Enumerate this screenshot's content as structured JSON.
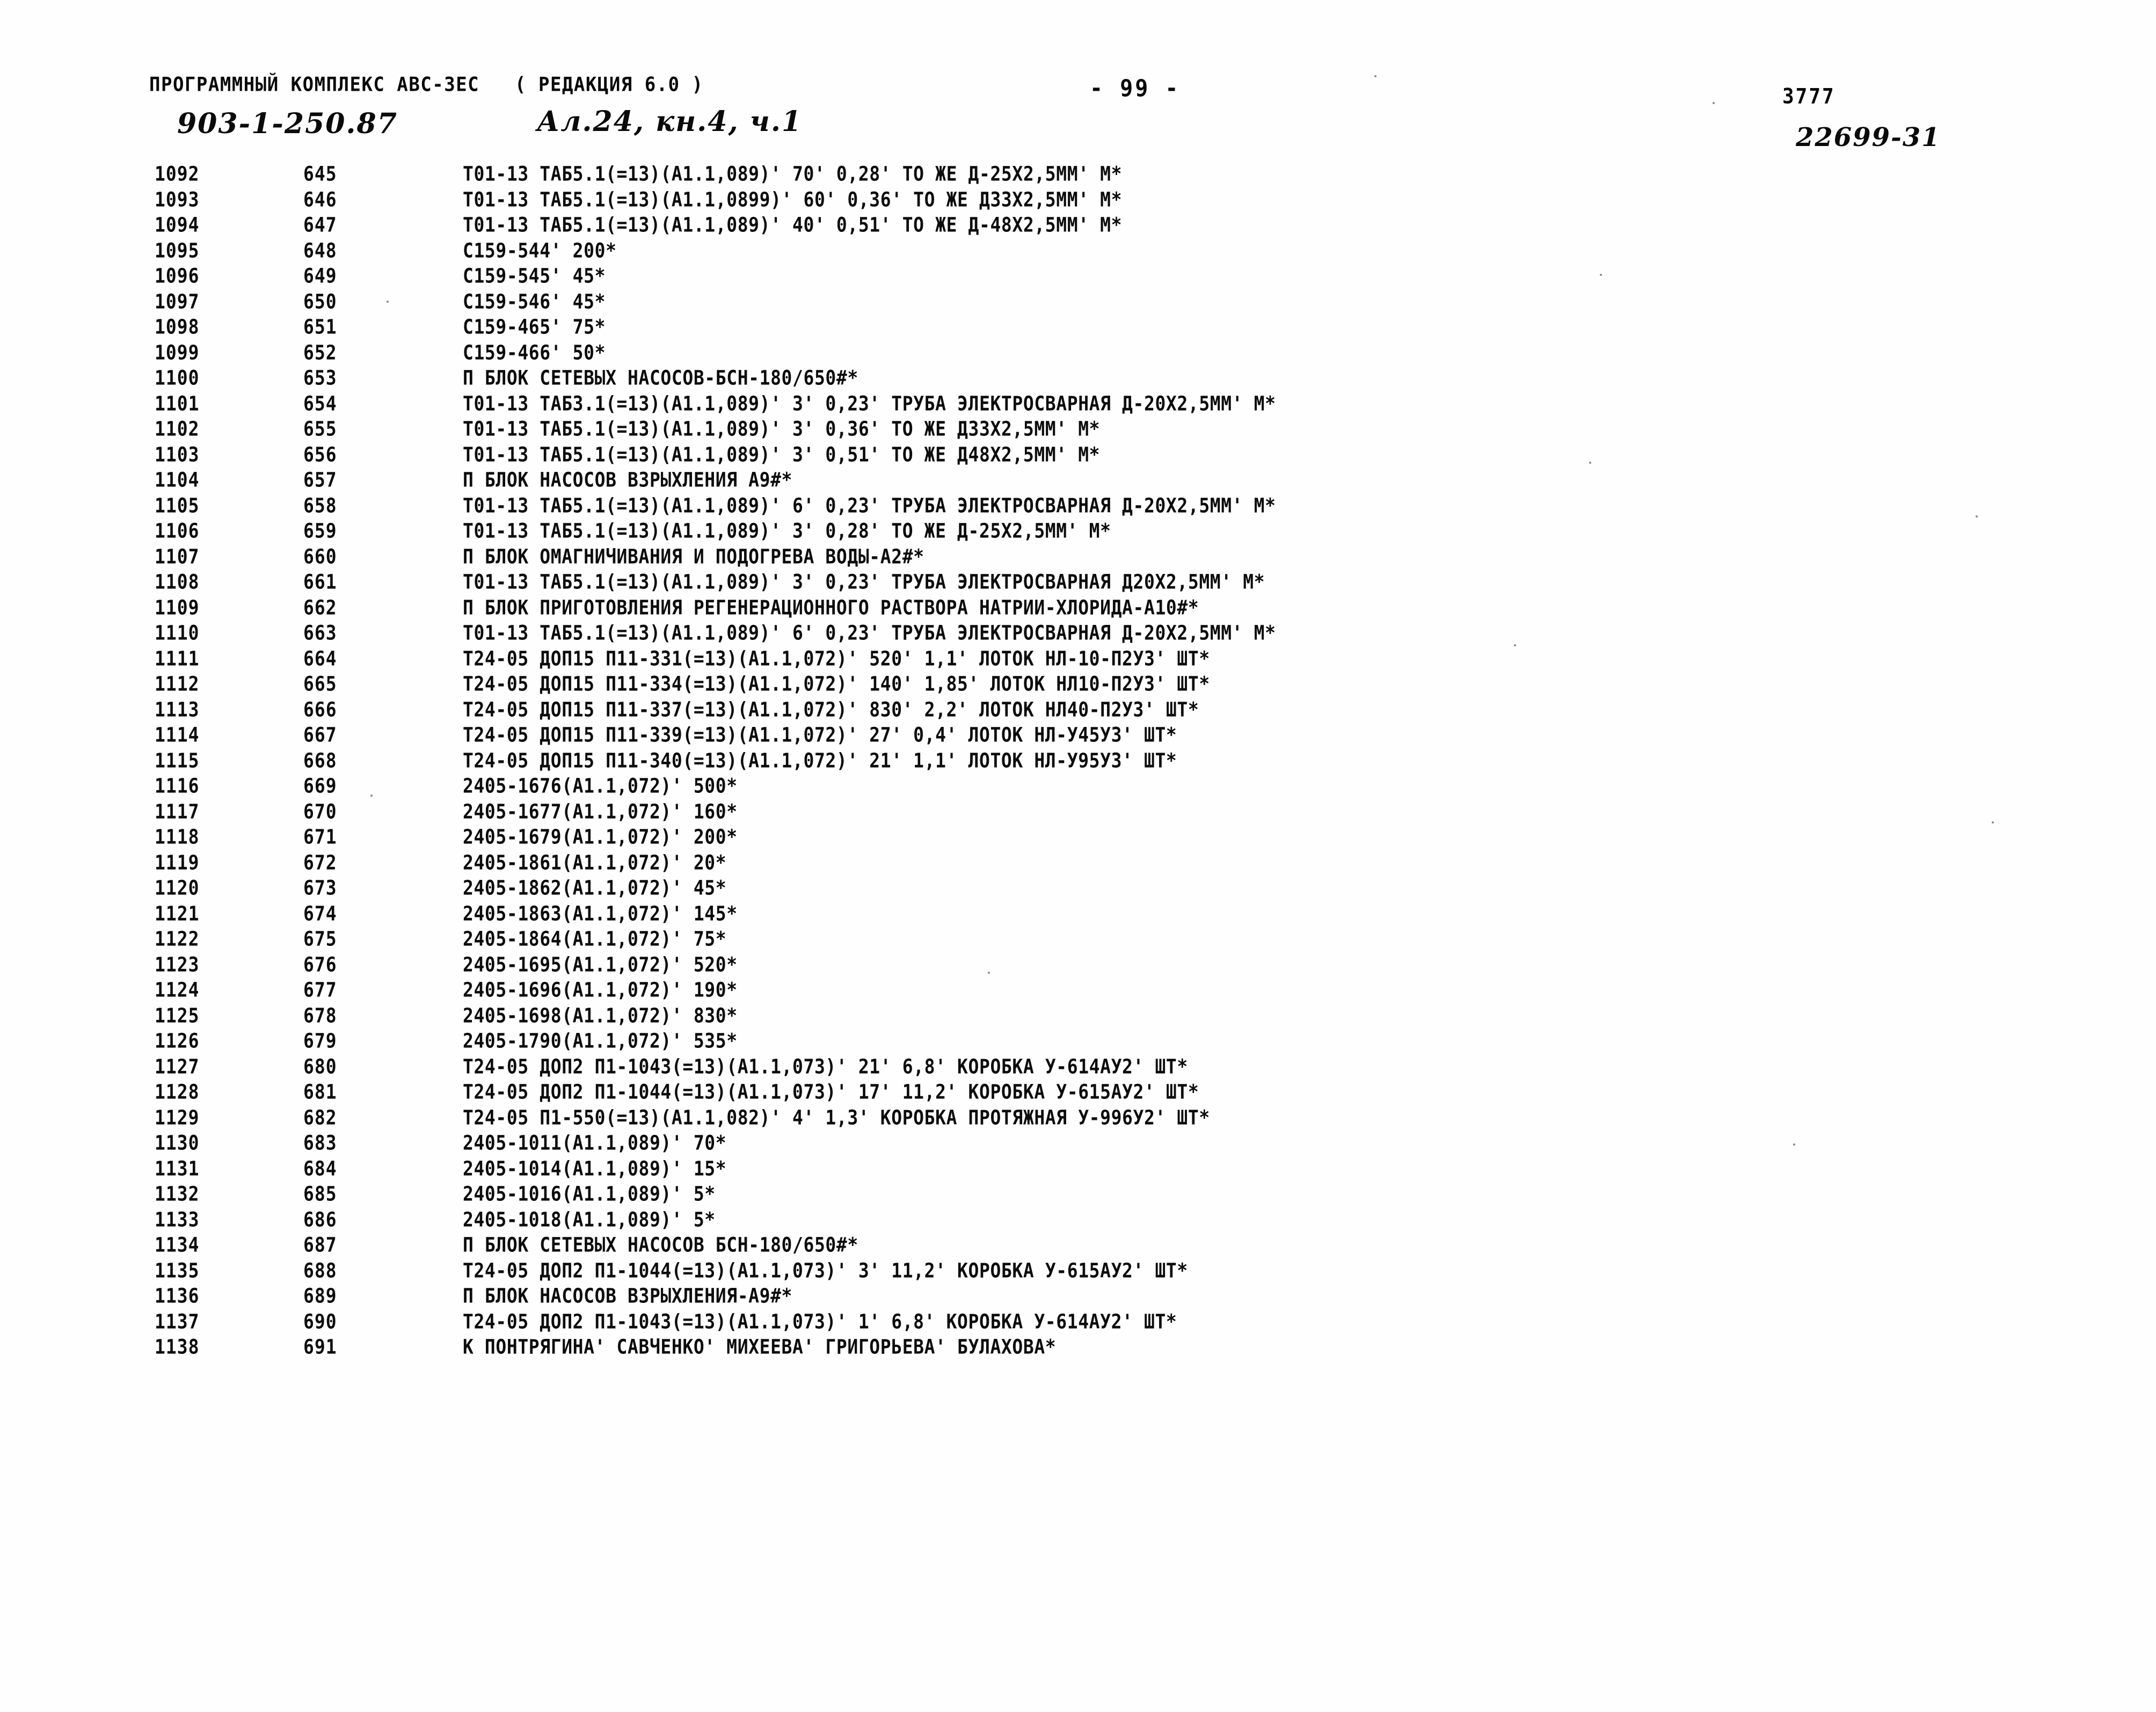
{
  "header": {
    "program_line": "ПРОГРАММНЫЙ КОМПЛЕКС АВС-ЗЕС   ( РЕДАКЦИЯ 6.0 )",
    "page_number": "- 99 -",
    "doc_code": "3777",
    "object_code": "903-1-250.87",
    "album_note": "Ал.24, кн.4, ч.1",
    "archive_number": "22699-31"
  },
  "listing": {
    "columns": [
      "seq",
      "pos",
      "text"
    ],
    "rows": [
      {
        "seq": "1092",
        "pos": "645",
        "text": "Т01-13 ТАБ5.1(=13)(А1.1,089)' 70' 0,28' ТО ЖЕ Д-25Х2,5ММ' М*"
      },
      {
        "seq": "1093",
        "pos": "646",
        "text": "Т01-13 ТАБ5.1(=13)(А1.1,0899)' 60' 0,36' ТО ЖЕ Д33Х2,5ММ' М*"
      },
      {
        "seq": "1094",
        "pos": "647",
        "text": "Т01-13 ТАБ5.1(=13)(А1.1,089)' 40' 0,51' ТО ЖЕ Д-48Х2,5ММ' М*"
      },
      {
        "seq": "1095",
        "pos": "648",
        "text": "С159-544' 200*"
      },
      {
        "seq": "1096",
        "pos": "649",
        "text": "С159-545' 45*"
      },
      {
        "seq": "1097",
        "pos": "650",
        "text": "С159-546' 45*"
      },
      {
        "seq": "1098",
        "pos": "651",
        "text": "С159-465' 75*"
      },
      {
        "seq": "1099",
        "pos": "652",
        "text": "С159-466' 50*"
      },
      {
        "seq": "1100",
        "pos": "653",
        "text": "П БЛОК СЕТЕВЫХ НАСОСОВ-БСН-180/650#*"
      },
      {
        "seq": "1101",
        "pos": "654",
        "text": "Т01-13 ТАБ3.1(=13)(А1.1,089)' 3' 0,23' ТРУБА ЭЛЕКТРОСВАРНАЯ Д-20Х2,5ММ' М*"
      },
      {
        "seq": "1102",
        "pos": "655",
        "text": "Т01-13 ТАБ5.1(=13)(А1.1,089)' 3' 0,36' ТО ЖЕ Д33Х2,5ММ' М*"
      },
      {
        "seq": "1103",
        "pos": "656",
        "text": "Т01-13 ТАБ5.1(=13)(А1.1,089)' 3' 0,51' ТО ЖЕ Д48Х2,5ММ' М*"
      },
      {
        "seq": "1104",
        "pos": "657",
        "text": "П БЛОК НАСОСОВ ВЗРЫХЛЕНИЯ А9#*"
      },
      {
        "seq": "1105",
        "pos": "658",
        "text": "Т01-13 ТАБ5.1(=13)(А1.1,089)' 6' 0,23' ТРУБА ЭЛЕКТРОСВАРНАЯ Д-20Х2,5ММ' М*"
      },
      {
        "seq": "1106",
        "pos": "659",
        "text": "Т01-13 ТАБ5.1(=13)(А1.1,089)' 3' 0,28' ТО ЖЕ Д-25Х2,5ММ' М*"
      },
      {
        "seq": "1107",
        "pos": "660",
        "text": "П БЛОК ОМАГНИЧИВАНИЯ И ПОДОГРЕВА ВОДЫ-А2#*"
      },
      {
        "seq": "1108",
        "pos": "661",
        "text": "Т01-13 ТАБ5.1(=13)(А1.1,089)' 3' 0,23' ТРУБА ЭЛЕКТРОСВАРНАЯ Д20Х2,5ММ' М*"
      },
      {
        "seq": "1109",
        "pos": "662",
        "text": "П БЛОК ПРИГОТОВЛЕНИЯ РЕГЕНЕРАЦИОННОГО РАСТВОРА НАТРИИ-ХЛОРИДА-А10#*"
      },
      {
        "seq": "1110",
        "pos": "663",
        "text": "Т01-13 ТАБ5.1(=13)(А1.1,089)' 6' 0,23' ТРУБА ЭЛЕКТРОСВАРНАЯ Д-20Х2,5ММ' М*"
      },
      {
        "seq": "1111",
        "pos": "664",
        "text": "Т24-05 ДОП15 П11-331(=13)(А1.1,072)' 520' 1,1' ЛОТОК НЛ-10-П2У3' ШТ*"
      },
      {
        "seq": "1112",
        "pos": "665",
        "text": "Т24-05 ДОП15 П11-334(=13)(А1.1,072)' 140' 1,85' ЛОТОК НЛ10-П2У3' ШТ*"
      },
      {
        "seq": "1113",
        "pos": "666",
        "text": "Т24-05 ДОП15 П11-337(=13)(А1.1,072)' 830' 2,2' ЛОТОК НЛ40-П2У3' ШТ*"
      },
      {
        "seq": "1114",
        "pos": "667",
        "text": "Т24-05 ДОП15 П11-339(=13)(А1.1,072)' 27' 0,4' ЛОТОК НЛ-У45У3' ШТ*"
      },
      {
        "seq": "1115",
        "pos": "668",
        "text": "Т24-05 ДОП15 П11-340(=13)(А1.1,072)' 21' 1,1' ЛОТОК НЛ-У95У3' ШТ*"
      },
      {
        "seq": "1116",
        "pos": "669",
        "text": "2405-1676(А1.1,072)' 500*"
      },
      {
        "seq": "1117",
        "pos": "670",
        "text": "2405-1677(А1.1,072)' 160*"
      },
      {
        "seq": "1118",
        "pos": "671",
        "text": "2405-1679(А1.1,072)' 200*"
      },
      {
        "seq": "1119",
        "pos": "672",
        "text": "2405-1861(А1.1,072)' 20*"
      },
      {
        "seq": "1120",
        "pos": "673",
        "text": "2405-1862(А1.1,072)' 45*"
      },
      {
        "seq": "1121",
        "pos": "674",
        "text": "2405-1863(А1.1,072)' 145*"
      },
      {
        "seq": "1122",
        "pos": "675",
        "text": "2405-1864(А1.1,072)' 75*"
      },
      {
        "seq": "1123",
        "pos": "676",
        "text": "2405-1695(А1.1,072)' 520*"
      },
      {
        "seq": "1124",
        "pos": "677",
        "text": "2405-1696(А1.1,072)' 190*"
      },
      {
        "seq": "1125",
        "pos": "678",
        "text": "2405-1698(А1.1,072)' 830*"
      },
      {
        "seq": "1126",
        "pos": "679",
        "text": "2405-1790(А1.1,072)' 535*"
      },
      {
        "seq": "1127",
        "pos": "680",
        "text": "Т24-05 ДОП2 П1-1043(=13)(А1.1,073)' 21' 6,8' КОРОБКА У-614АУ2' ШТ*"
      },
      {
        "seq": "1128",
        "pos": "681",
        "text": "Т24-05 ДОП2 П1-1044(=13)(А1.1,073)' 17' 11,2' КОРОБКА У-615АУ2' ШТ*"
      },
      {
        "seq": "1129",
        "pos": "682",
        "text": "Т24-05 П1-550(=13)(А1.1,082)' 4' 1,3' КОРОБКА ПРОТЯЖНАЯ У-996У2' ШТ*"
      },
      {
        "seq": "1130",
        "pos": "683",
        "text": "2405-1011(А1.1,089)' 70*"
      },
      {
        "seq": "1131",
        "pos": "684",
        "text": "2405-1014(А1.1,089)' 15*"
      },
      {
        "seq": "1132",
        "pos": "685",
        "text": "2405-1016(А1.1,089)' 5*"
      },
      {
        "seq": "1133",
        "pos": "686",
        "text": "2405-1018(А1.1,089)' 5*"
      },
      {
        "seq": "1134",
        "pos": "687",
        "text": "П БЛОК СЕТЕВЫХ НАСОСОВ БСН-180/650#*"
      },
      {
        "seq": "1135",
        "pos": "688",
        "text": "Т24-05 ДОП2 П1-1044(=13)(А1.1,073)' 3' 11,2' КОРОБКА У-615АУ2' ШТ*"
      },
      {
        "seq": "1136",
        "pos": "689",
        "text": "П БЛОК НАСОСОВ ВЗРЫХЛЕНИЯ-А9#*"
      },
      {
        "seq": "1137",
        "pos": "690",
        "text": "Т24-05 ДОП2 П1-1043(=13)(А1.1,073)' 1' 6,8' КОРОБКА У-614АУ2' ШТ*"
      },
      {
        "seq": "1138",
        "pos": "691",
        "text": "К ПОНТРЯГИНА' САВЧЕНКО' МИХЕЕВА' ГРИГОРЬЕВА' БУЛАХОВА*"
      }
    ]
  }
}
